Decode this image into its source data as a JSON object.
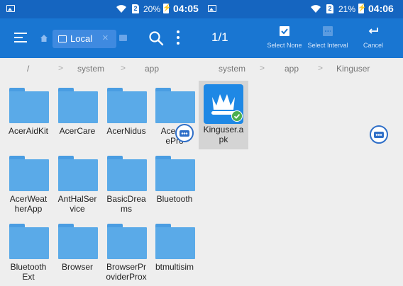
{
  "status_left": {
    "signal_badge": "2",
    "battery_percent": "20%",
    "time": "04:05"
  },
  "status_right": {
    "signal_badge": "2",
    "battery_percent": "21%",
    "time": "04:06"
  },
  "toolbar_left": {
    "tab_label": "Local",
    "tab_close": "×"
  },
  "toolbar_right": {
    "selection_count": "1/1",
    "select_none_label": "Select None",
    "select_interval_label": "Select Interval",
    "cancel_label": "Cancel"
  },
  "breadcrumb_left": {
    "sep": ">",
    "items": [
      "/",
      "system",
      "app"
    ]
  },
  "breadcrumb_right": {
    "sep": ">",
    "items": [
      "system",
      "app",
      "Kinguser"
    ]
  },
  "folders": [
    "AcerAidKit",
    "AcerCare",
    "AcerNidus",
    "AcerThemeProvider",
    "AcerWeatherApp",
    "AntHalService",
    "BasicDreams",
    "Bluetooth",
    "BluetoothExt",
    "Browser",
    "BrowserProviderProx",
    "btmultisim"
  ],
  "folder_label_lines": [
    [
      "AcerAidKit"
    ],
    [
      "AcerCare"
    ],
    [
      "AcerNidus"
    ],
    [
      "AcerTh",
      "ePro"
    ],
    [
      "AcerWeat",
      "herApp"
    ],
    [
      "AntHalSer",
      "vice"
    ],
    [
      "BasicDrea",
      "ms"
    ],
    [
      "Bluetooth"
    ],
    [
      "Bluetooth",
      "Ext"
    ],
    [
      "Browser"
    ],
    [
      "BrowserPr",
      "oviderProx"
    ],
    [
      "btmultisim"
    ]
  ],
  "apk_file": {
    "label_line1": "Kinguser.a",
    "label_line2": "pk",
    "selected": true
  },
  "colors": {
    "status_bar": "#1565c0",
    "toolbar": "#1976d2",
    "folder": "#5aaae8",
    "check": "#4caf50",
    "selected_tile": "#d4d4d4"
  },
  "icons": [
    "menu-icon",
    "home-icon",
    "storage-icon",
    "close-icon",
    "search-icon",
    "more-vert-icon",
    "check-box-icon",
    "select-interval-icon",
    "cancel-return-icon",
    "kingroot-crown-icon",
    "check-badge-icon",
    "floating-assist-icon"
  ]
}
